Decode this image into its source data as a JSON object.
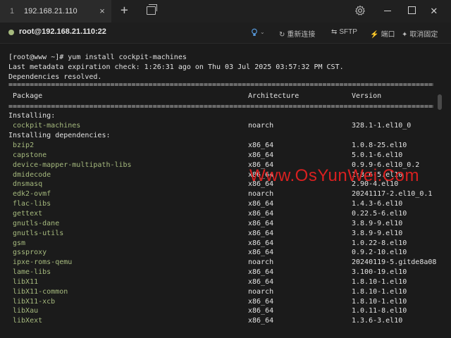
{
  "tab": {
    "index": "1",
    "title": "192.168.21.110"
  },
  "session": {
    "title": "root@192.168.21.110:22"
  },
  "toolbar": {
    "reconnect": "重新连接",
    "sftp": "SFTP",
    "ports": "端口",
    "unpin": "取消固定"
  },
  "colors": {
    "accent_green": "#a6ba7e",
    "bulb_blue": "#5aa0e6",
    "watermark_red": "#d82020"
  },
  "terminal": {
    "prompt_line": "[root@www ~]# yum install cockpit-machines",
    "metadata_line": "Last metadata expiration check: 1:26:31 ago on Thu 03 Jul 2025 03:57:32 PM CST.",
    "resolved_line": "Dependencies resolved.",
    "separator_double": "================================================================================================================================",
    "separator_single": "================================================================================================================================",
    "headers": {
      "package": "Package",
      "architecture": "Architecture",
      "version": "Version"
    },
    "installing_label": "Installing:",
    "installing_deps_label": "Installing dependencies:",
    "installing": [
      {
        "name": "cockpit-machines",
        "arch": "noarch",
        "version": "328.1-1.el10_0"
      }
    ],
    "dependencies": [
      {
        "name": "bzip2",
        "arch": "x86_64",
        "version": "1.0.8-25.el10"
      },
      {
        "name": "capstone",
        "arch": "x86_64",
        "version": "5.0.1-6.el10"
      },
      {
        "name": "device-mapper-multipath-libs",
        "arch": "x86_64",
        "version": "0.9.9-6.el10_0.2"
      },
      {
        "name": "dmidecode",
        "arch": "x86_64",
        "version": "1:3.6-5.el10"
      },
      {
        "name": "dnsmasq",
        "arch": "x86_64",
        "version": "2.90-4.el10"
      },
      {
        "name": "edk2-ovmf",
        "arch": "noarch",
        "version": "20241117-2.el10_0.1"
      },
      {
        "name": "flac-libs",
        "arch": "x86_64",
        "version": "1.4.3-6.el10"
      },
      {
        "name": "gettext",
        "arch": "x86_64",
        "version": "0.22.5-6.el10"
      },
      {
        "name": "gnutls-dane",
        "arch": "x86_64",
        "version": "3.8.9-9.el10"
      },
      {
        "name": "gnutls-utils",
        "arch": "x86_64",
        "version": "3.8.9-9.el10"
      },
      {
        "name": "gsm",
        "arch": "x86_64",
        "version": "1.0.22-8.el10"
      },
      {
        "name": "gssproxy",
        "arch": "x86_64",
        "version": "0.9.2-10.el10"
      },
      {
        "name": "ipxe-roms-qemu",
        "arch": "noarch",
        "version": "20240119-5.gitde8a08"
      },
      {
        "name": "lame-libs",
        "arch": "x86_64",
        "version": "3.100-19.el10"
      },
      {
        "name": "libX11",
        "arch": "x86_64",
        "version": "1.8.10-1.el10"
      },
      {
        "name": "libX11-common",
        "arch": "noarch",
        "version": "1.8.10-1.el10"
      },
      {
        "name": "libX11-xcb",
        "arch": "x86_64",
        "version": "1.8.10-1.el10"
      },
      {
        "name": "libXau",
        "arch": "x86_64",
        "version": "1.0.11-8.el10"
      },
      {
        "name": "libXext",
        "arch": "x86_64",
        "version": "1.3.6-3.el10"
      }
    ]
  },
  "watermark": "Www.OsYunWei.Com"
}
